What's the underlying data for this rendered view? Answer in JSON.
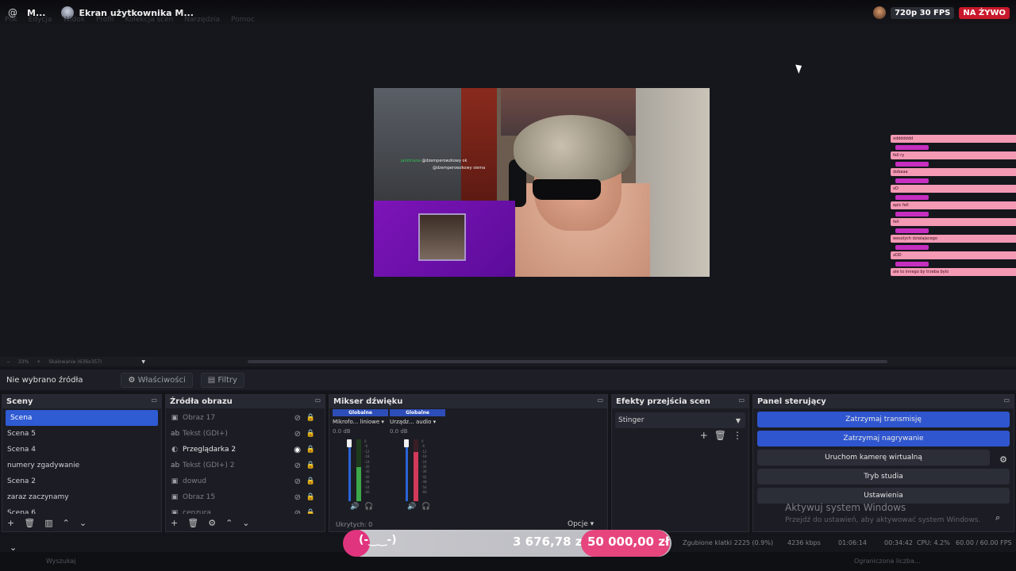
{
  "titlebar": {
    "app_short": "M...",
    "window_title": "Ekran użytkownika M...",
    "resolution": "720p 30 FPS",
    "live": "NA ŻYWO"
  },
  "menu": [
    "Plik",
    "Edycja",
    "Widok",
    "Profil",
    "Kolekcja scen",
    "Narzędzia",
    "Pomoc"
  ],
  "canvas_chat": {
    "line1_name": "jacktriana",
    "line1_text": "@dzemperowzkowy ok",
    "line2_text": "@dzemperowzkowy siema"
  },
  "chat_overlay": [
    {
      "name": "",
      "text": "xddddddd"
    },
    {
      "name": "",
      "text": "fell ry"
    },
    {
      "name": "",
      "text": "dobaaa"
    },
    {
      "name": "",
      "text": "xD"
    },
    {
      "name": "",
      "text": "epic fell"
    },
    {
      "name": "",
      "text": "fell"
    },
    {
      "name": "",
      "text": "wesolych dzialajacego"
    },
    {
      "name": "",
      "text": "xDD"
    },
    {
      "name": "",
      "text": "ale to innego by trzeba bylo"
    }
  ],
  "zoom": {
    "percent": "33%",
    "scale_label": "Skalowanie (636x357)"
  },
  "source_toolbar": {
    "no_source": "Nie wybrano źródła",
    "properties": "Właściwości",
    "filters": "Filtry"
  },
  "scenes": {
    "title": "Sceny",
    "items": [
      "Scena",
      "Scena 5",
      "Scena 4",
      "numery zgadywanie",
      "Scena 2",
      "zaraz zaczynamy",
      "Scena 6"
    ]
  },
  "sources": {
    "title": "Źródła obrazu",
    "items": [
      {
        "label": "Obraz 17",
        "icon": "image-icon",
        "visible": false
      },
      {
        "label": "Tekst (GDI+)",
        "icon": "text-icon",
        "visible": false
      },
      {
        "label": "Przeglądarka 2",
        "icon": "browser-icon",
        "visible": true
      },
      {
        "label": "Tekst (GDI+) 2",
        "icon": "text-icon",
        "visible": false
      },
      {
        "label": "dowud",
        "icon": "image-icon",
        "visible": false
      },
      {
        "label": "Obraz 15",
        "icon": "image-icon",
        "visible": false
      },
      {
        "label": "cenzura",
        "icon": "image-icon",
        "visible": false
      }
    ]
  },
  "mixer": {
    "title": "Mikser dźwięku",
    "channels": [
      {
        "scope": "Globalne",
        "device": "Mikrofo... liniowe",
        "db": "0.0 dB",
        "level": 0.55
      },
      {
        "scope": "Globalne",
        "device": "Urządz... audio",
        "db": "0.0 dB",
        "level": 0.8
      }
    ],
    "scale": [
      "0",
      "-6",
      "-12",
      "-18",
      "-24",
      "-30",
      "-36",
      "-42",
      "-48",
      "-54",
      "-60"
    ],
    "hidden": "Ukrytych: 0",
    "options": "Opcje"
  },
  "transitions": {
    "title": "Efekty przejścia scen",
    "selected": "Stinger"
  },
  "controls": {
    "title": "Panel sterujący",
    "buttons": [
      "Zatrzymaj transmisję",
      "Zatrzymaj nagrywanie",
      "Uruchom kamerę wirtualną",
      "Tryb studia",
      "Ustawienia"
    ]
  },
  "watermark": {
    "line1": "Aktywuj system Windows",
    "line2": "Przejdź do ustawień, aby aktywować system Windows."
  },
  "donation": {
    "emoji": "(-‿‿-)",
    "amount": "3 676,78 zł",
    "goal": "50 000,00 zł"
  },
  "status": {
    "dropped": "Zgubione klatki 2225 (0.9%)",
    "bitrate": "4236 kbps",
    "live_time": "01:06:14",
    "rec_time": "00:34:42",
    "cpu": "CPU: 4.2%",
    "fps": "60.00 / 60.00 FPS"
  },
  "taskbar": {
    "search": "Wyszukaj",
    "weather": "Ograniczona liczba..."
  },
  "colors": {
    "accent": "#2f56cf",
    "live": "#c8182a",
    "purple": "#7d14b8",
    "chat": "#f49ab5"
  }
}
